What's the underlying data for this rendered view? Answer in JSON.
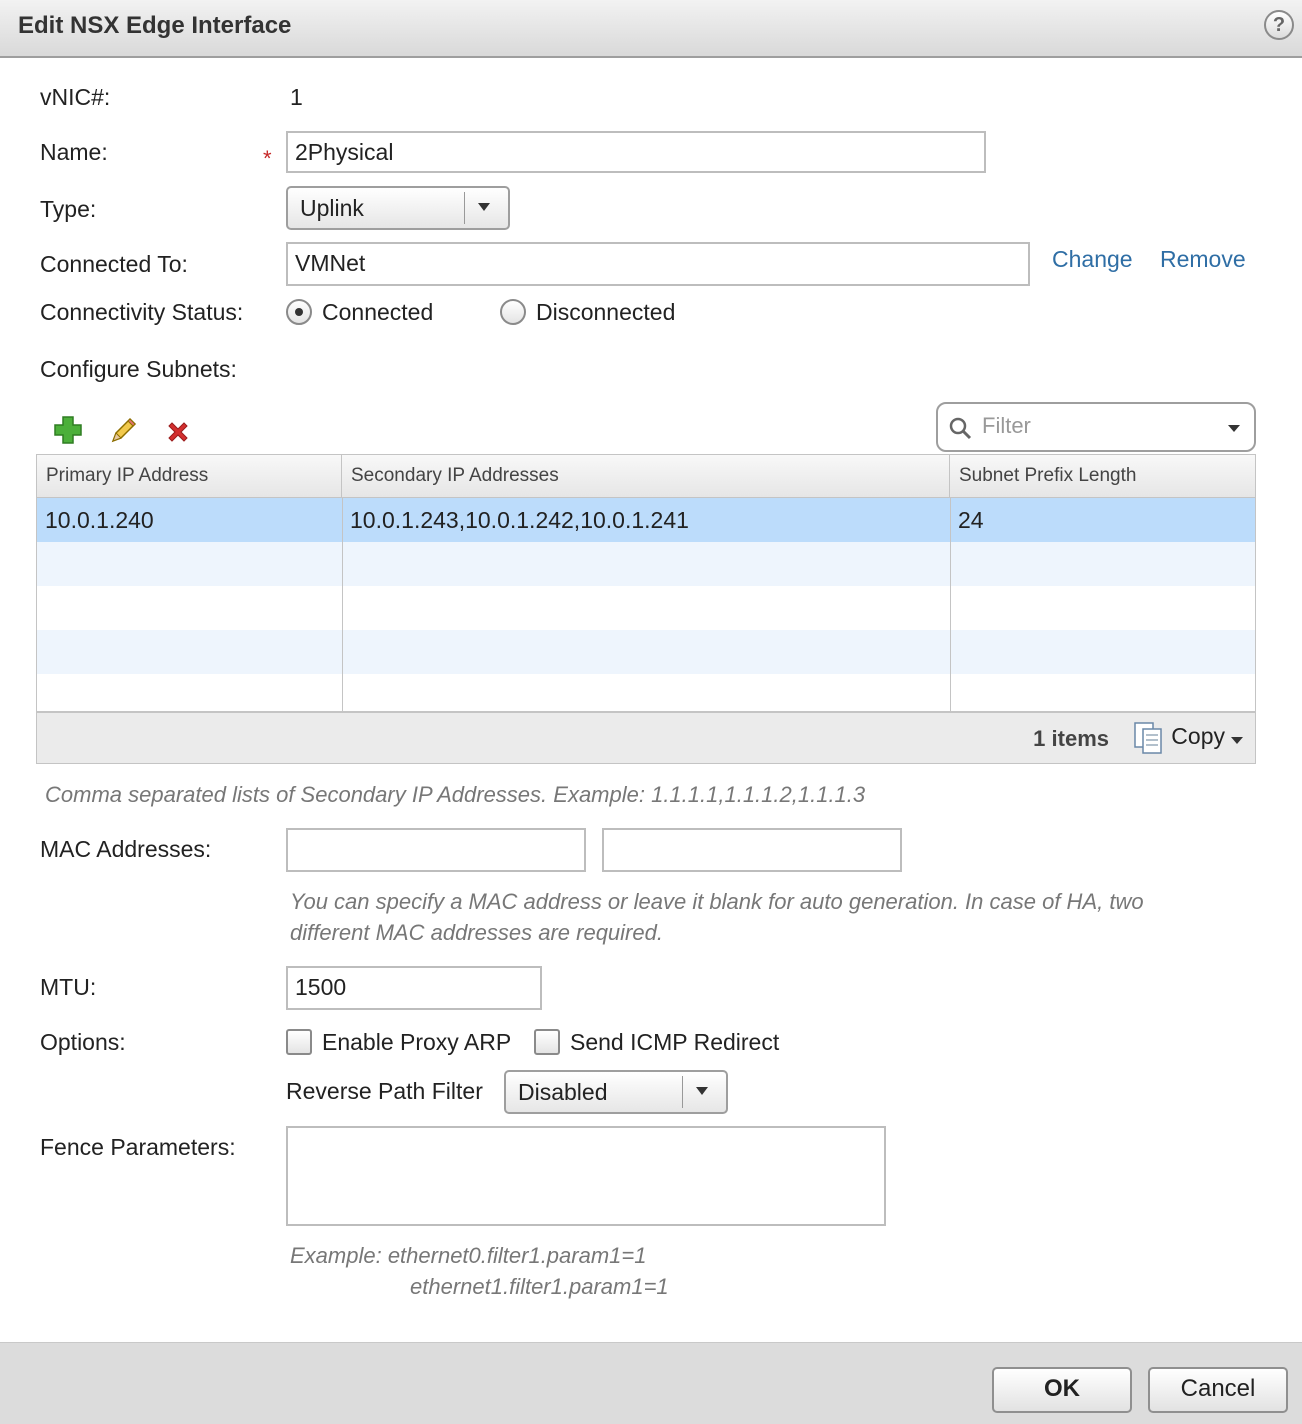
{
  "dialog": {
    "title": "Edit NSX Edge Interface",
    "help": "?"
  },
  "vnic": {
    "label": "vNIC#:",
    "value": "1"
  },
  "name": {
    "label": "Name:",
    "required": "*",
    "value": "2Physical"
  },
  "type": {
    "label": "Type:",
    "value": "Uplink"
  },
  "connected_to": {
    "label": "Connected To:",
    "value": "VMNet",
    "change": "Change",
    "remove": "Remove"
  },
  "connectivity": {
    "label": "Connectivity Status:",
    "connected": "Connected",
    "disconnected": "Disconnected",
    "selected": "Connected"
  },
  "subnets": {
    "label": "Configure Subnets:",
    "filter_placeholder": "Filter",
    "columns": [
      "Primary IP Address",
      "Secondary IP Addresses",
      "Subnet Prefix Length"
    ],
    "rows": [
      {
        "primary": "10.0.1.240",
        "secondary": "10.0.1.243,10.0.1.242,10.0.1.241",
        "prefix": "24"
      }
    ],
    "items_count": "1 items",
    "copy_label": "Copy",
    "hint": "Comma separated lists of Secondary IP Addresses. Example: 1.1.1.1,1.1.1.2,1.1.1.3"
  },
  "mac": {
    "label": "MAC Addresses:",
    "value1": "",
    "value2": "",
    "hint_line1": "You can specify a MAC address or leave it blank for auto generation. In case of HA, two",
    "hint_line2": "different MAC addresses are required."
  },
  "mtu": {
    "label": "MTU:",
    "value": "1500"
  },
  "options": {
    "label": "Options:",
    "proxy_arp": "Enable Proxy ARP",
    "icmp_redirect": "Send ICMP Redirect",
    "rpf_label": "Reverse Path Filter",
    "rpf_value": "Disabled"
  },
  "fence": {
    "label": "Fence Parameters:",
    "value": "",
    "example_line1": "Example: ethernet0.filter1.param1=1",
    "example_line2": "ethernet1.filter1.param1=1"
  },
  "buttons": {
    "ok": "OK",
    "cancel": "Cancel"
  },
  "colors": {
    "link": "#2f6ea5",
    "selected_row": "#bcdcfb",
    "required": "#c62828"
  }
}
